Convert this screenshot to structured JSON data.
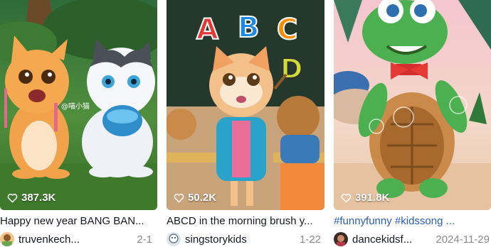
{
  "videos": [
    {
      "likes": "387.3K",
      "title": "Happy new year BANG BAN...",
      "author": "truvenkech...",
      "date": "2-1",
      "title_is_hashtag": false
    },
    {
      "likes": "50.2K",
      "title": "ABCD in the morning brush y...",
      "author": "singstorykids",
      "date": "1-22",
      "title_is_hashtag": false
    },
    {
      "likes": "391.8K",
      "title": "#funnyfunny #kidssong ...",
      "author": "dancekidsf...",
      "date": "2024-11-29",
      "title_is_hashtag": true
    }
  ],
  "thumbnail_text": {
    "letters": [
      "A",
      "B",
      "C",
      "D"
    ],
    "watermark": "@喵小猫"
  },
  "colors": {
    "text": "#161823",
    "hashtag": "#2b5db9",
    "date": "#8a8b91",
    "likes": "#ffffff"
  },
  "icons": {
    "like": "heart-outline-icon"
  }
}
